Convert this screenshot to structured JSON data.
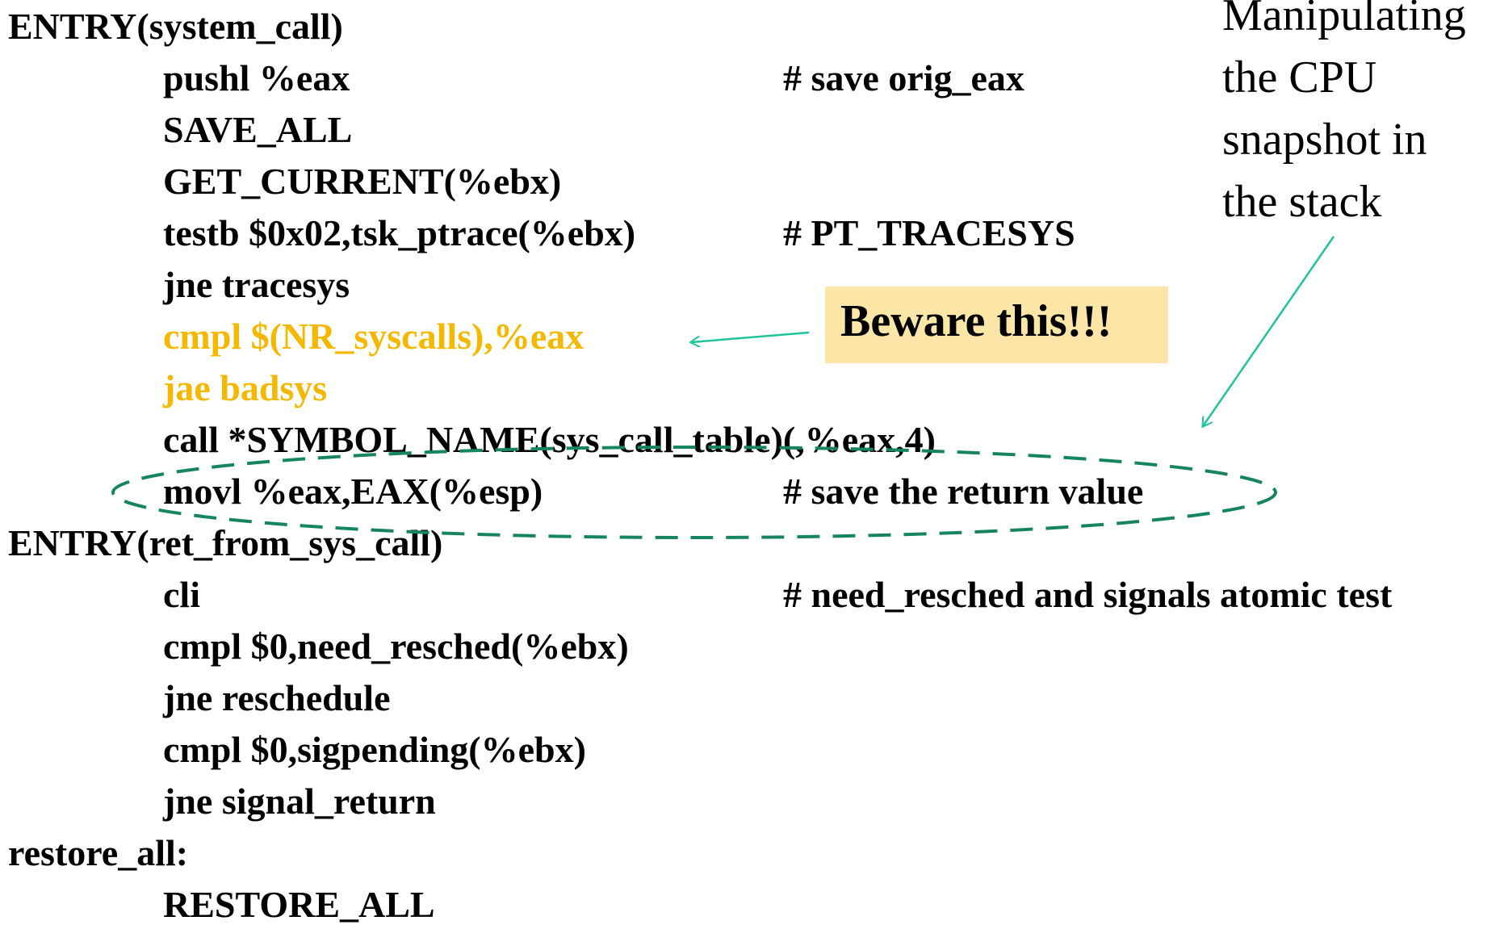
{
  "code_lines": [
    {
      "code": "ENTRY(system_call)",
      "comment": ""
    },
    {
      "code": "pushl %eax",
      "comment": "# save orig_eax"
    },
    {
      "code": "SAVE_ALL",
      "comment": ""
    },
    {
      "code": "GET_CURRENT(%ebx)",
      "comment": ""
    },
    {
      "code": "testb $0x02,tsk_ptrace(%ebx)",
      "comment": "# PT_TRACESYS"
    },
    {
      "code": "jne tracesys",
      "comment": ""
    },
    {
      "code": "cmpl $(NR_syscalls),%eax",
      "comment": "",
      "highlight": true
    },
    {
      "code": "jae badsys",
      "comment": "",
      "highlight": true
    },
    {
      "code": "call *SYMBOL_NAME(sys_call_table)(,%eax,4)",
      "comment": ""
    },
    {
      "code": "movl %eax,EAX(%esp)",
      "comment": "# save the return value"
    },
    {
      "code": "ENTRY(ret_from_sys_call)",
      "comment": ""
    },
    {
      "code": "cli",
      "comment": "# need_resched and signals atomic test"
    },
    {
      "code": "cmpl $0,need_resched(%ebx)",
      "comment": ""
    },
    {
      "code": "jne reschedule",
      "comment": ""
    },
    {
      "code": "cmpl $0,sigpending(%ebx)",
      "comment": ""
    },
    {
      "code": "jne signal_return",
      "comment": ""
    },
    {
      "code": "restore_all:",
      "comment": ""
    },
    {
      "code": "RESTORE_ALL",
      "comment": ""
    }
  ],
  "annotations": {
    "beware": "Beware this!!!",
    "manipulating": [
      "Manipulating",
      "the CPU",
      "snapshot in",
      "the stack"
    ]
  },
  "colors": {
    "highlight_text": "#f5b800",
    "callout_bg": "#fbe5a7",
    "arrow": "#1fc49a",
    "dashed_ellipse": "#16855f"
  }
}
